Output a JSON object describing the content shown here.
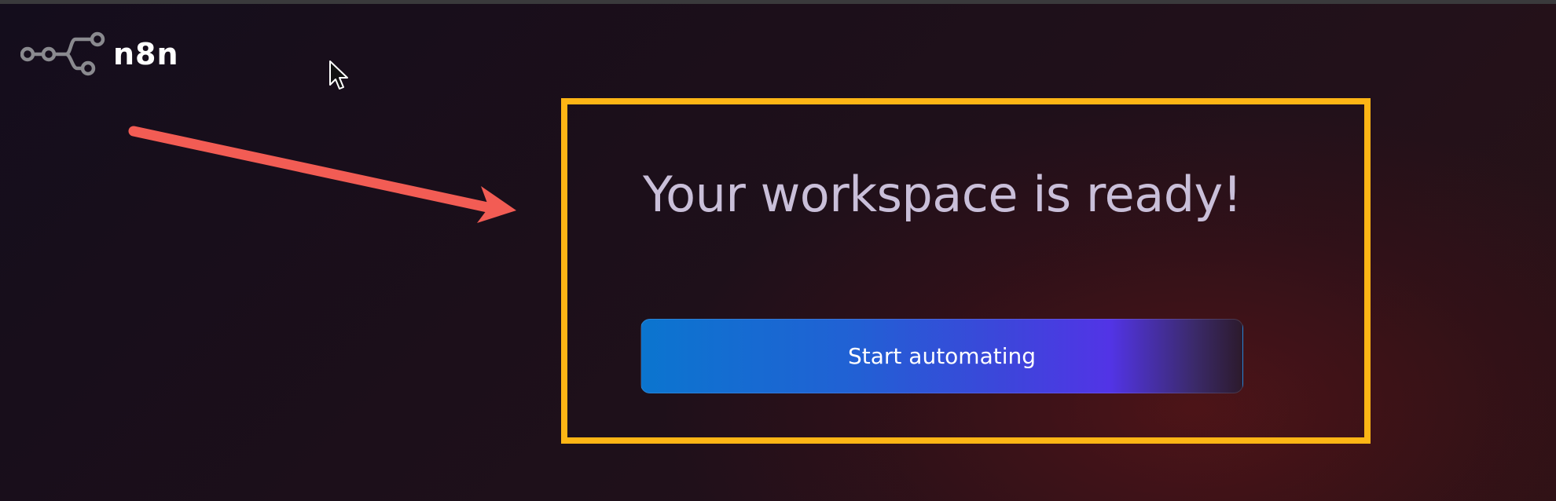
{
  "brand": {
    "logo_text": "n8n",
    "logo_icon": "n8n-node-graph-icon"
  },
  "main": {
    "headline": "Your workspace is ready!",
    "cta_label": "Start automating"
  },
  "annotations": {
    "arrow_icon": "red-pointer-arrow",
    "highlight_color": "#fdb515",
    "arrow_color": "#f25c54"
  },
  "colors": {
    "headline": "#c9bfd9",
    "button_gradient_start": "#0b75cf",
    "button_gradient_end": "#5234e6"
  }
}
